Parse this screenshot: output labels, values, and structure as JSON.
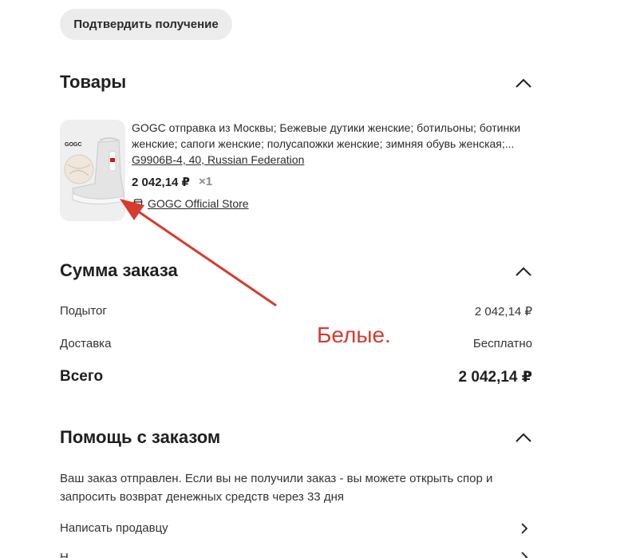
{
  "confirm_button": {
    "label": "Подтвердить получение"
  },
  "products_section": {
    "title": "Товары",
    "item": {
      "brand_on_image": "GOGC",
      "title": "GOGC отправка из Москвы; Бежевые дутики женские; ботильоны; ботинки женские; сапоги женские; полусапожки женские; зимняя обувь женская;...",
      "variant": "G9906B-4, 40, Russian Federation",
      "price": "2 042,14 ₽",
      "quantity": "×1",
      "store": "GOGC Official Store"
    }
  },
  "summary_section": {
    "title": "Сумма заказа",
    "subtotal_label": "Подытог",
    "subtotal_value": "2 042,14 ₽",
    "delivery_label": "Доставка",
    "delivery_value": "Бесплатно",
    "total_label": "Всего",
    "total_value": "2 042,14 ₽"
  },
  "help_section": {
    "title": "Помощь с заказом",
    "text": "Ваш заказ отправлен. Если вы не получили заказ - вы можете открыть спор и запросить возврат денежных средств через 33 дня",
    "links": [
      "Написать продавцу",
      "Н"
    ]
  },
  "annotation": {
    "text": "Белые.",
    "color": "#d83a2e"
  }
}
